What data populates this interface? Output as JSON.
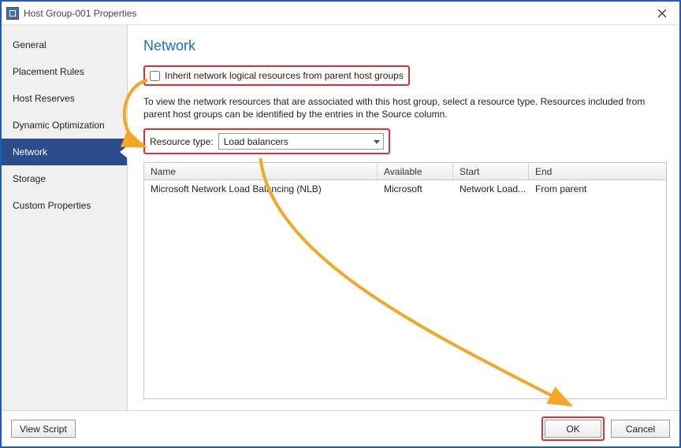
{
  "window": {
    "title": "Host Group-001 Properties"
  },
  "sidebar": {
    "items": [
      {
        "label": "General"
      },
      {
        "label": "Placement Rules"
      },
      {
        "label": "Host Reserves"
      },
      {
        "label": "Dynamic Optimization"
      },
      {
        "label": "Network",
        "selected": true
      },
      {
        "label": "Storage"
      },
      {
        "label": "Custom Properties"
      }
    ]
  },
  "main": {
    "title": "Network",
    "inherit_checkbox_label": "Inherit network logical resources from parent host groups",
    "inherit_checked": false,
    "description": "To view the network resources that are associated with this host group, select a resource type. Resources included from parent host groups can be identified by the entries in the Source column.",
    "resource_type_label": "Resource type:",
    "resource_type_value": "Load balancers",
    "table": {
      "columns": {
        "name": "Name",
        "available": "Available",
        "start": "Start",
        "end": "End"
      },
      "rows": [
        {
          "name": "Microsoft Network Load Balancing (NLB)",
          "available": "Microsoft",
          "start": "Network Load...",
          "end": "From parent"
        }
      ]
    }
  },
  "footer": {
    "view_script": "View Script",
    "ok": "OK",
    "cancel": "Cancel"
  },
  "annotation": {
    "arrow_color": "#f5a623",
    "highlight_color": "#e03131"
  }
}
